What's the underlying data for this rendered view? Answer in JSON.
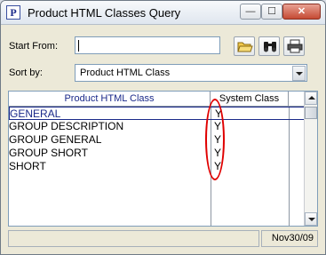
{
  "window": {
    "title": "Product HTML Classes Query",
    "app_icon_letter": "P",
    "minimize_glyph": "—",
    "maximize_glyph": "☐",
    "close_glyph": "✕"
  },
  "form": {
    "start_from_label": "Start From:",
    "start_from_value": "",
    "sort_by_label": "Sort by:",
    "sort_by_value": "Product HTML Class"
  },
  "toolbar": {
    "icons": [
      "open-folder-icon",
      "binoculars-icon",
      "printer-icon"
    ]
  },
  "grid": {
    "columns": [
      "Product HTML Class",
      "System Class"
    ],
    "rows": [
      {
        "name": "GENERAL",
        "system": "Y",
        "selected": true
      },
      {
        "name": "GROUP DESCRIPTION",
        "system": "Y",
        "selected": false
      },
      {
        "name": "GROUP GENERAL",
        "system": "Y",
        "selected": false
      },
      {
        "name": "GROUP SHORT",
        "system": "Y",
        "selected": false
      },
      {
        "name": "SHORT",
        "system": "Y",
        "selected": false
      }
    ]
  },
  "status": {
    "left_text": "",
    "date": "Nov30/09"
  },
  "colors": {
    "annotation": "#e00000",
    "selection": "#1b2a8a"
  }
}
